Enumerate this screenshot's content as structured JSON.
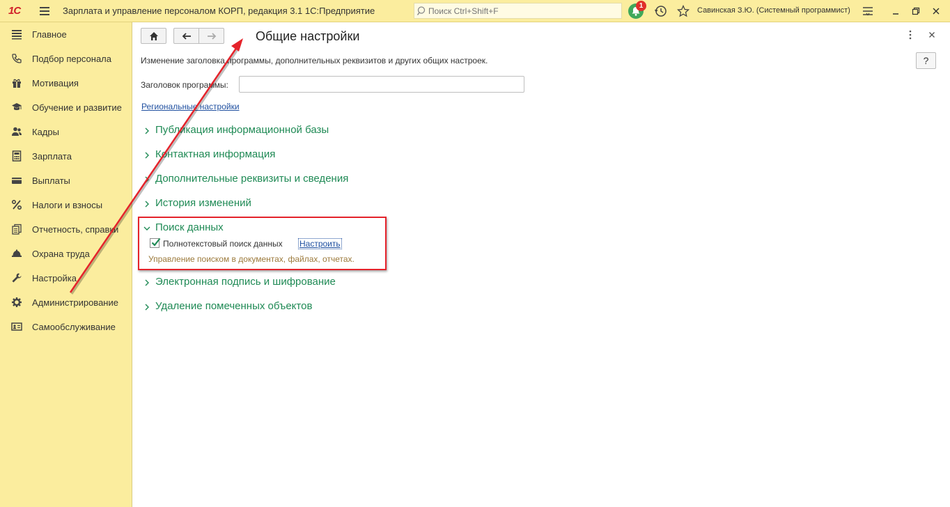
{
  "titlebar": {
    "logo": "1С",
    "app_title": "Зарплата и управление персоналом КОРП, редакция 3.1 1С:Предприятие",
    "search_placeholder": "Поиск Ctrl+Shift+F",
    "notifications_count": "1",
    "user": "Савинская З.Ю. (Системный программист)"
  },
  "sidebar": {
    "items": [
      {
        "label": "Главное",
        "icon": "list-icon"
      },
      {
        "label": "Подбор персонала",
        "icon": "phone-icon"
      },
      {
        "label": "Мотивация",
        "icon": "gift-icon"
      },
      {
        "label": "Обучение и развитие",
        "icon": "graduation-cap-icon"
      },
      {
        "label": "Кадры",
        "icon": "people-icon"
      },
      {
        "label": "Зарплата",
        "icon": "calculator-icon"
      },
      {
        "label": "Выплаты",
        "icon": "wallet-icon"
      },
      {
        "label": "Налоги и взносы",
        "icon": "percent-icon"
      },
      {
        "label": "Отчетность, справки",
        "icon": "documents-icon"
      },
      {
        "label": "Охрана труда",
        "icon": "helmet-icon"
      },
      {
        "label": "Настройка",
        "icon": "wrench-icon"
      },
      {
        "label": "Администрирование",
        "icon": "gear-icon"
      },
      {
        "label": "Самообслуживание",
        "icon": "id-card-icon"
      }
    ]
  },
  "main": {
    "title": "Общие настройки",
    "help_label": "?",
    "description": "Изменение заголовка программы, дополнительных реквизитов и других общих настроек.",
    "program_title_label": "Заголовок программы:",
    "program_title_value": "",
    "regional_link": "Региональные настройки",
    "sections": [
      {
        "label": "Публикация информационной базы",
        "expanded": false
      },
      {
        "label": "Контактная информация",
        "expanded": false
      },
      {
        "label": "Дополнительные реквизиты и сведения",
        "expanded": false
      },
      {
        "label": "История изменений",
        "expanded": false
      },
      {
        "label": "Поиск данных",
        "expanded": true
      },
      {
        "label": "Электронная подпись и шифрование",
        "expanded": false
      },
      {
        "label": "Удаление помеченных объектов",
        "expanded": false
      }
    ],
    "search_data": {
      "fulltext_label": "Полнотекстовый поиск данных",
      "fulltext_checked": true,
      "configure_link": "Настроить",
      "hint": "Управление поиском в документах, файлах, отчетах."
    }
  },
  "colors": {
    "panel_yellow": "#fbed9e",
    "section_green": "#1f8a55",
    "highlight_red": "#e5232b",
    "link_blue": "#2050a0",
    "hint_brown": "#9c7a3c"
  }
}
